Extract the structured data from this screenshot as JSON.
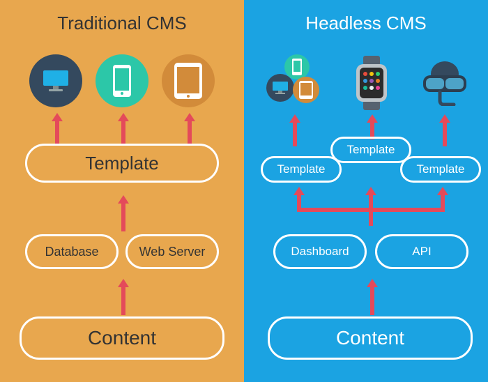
{
  "left": {
    "title": "Traditional CMS",
    "content_label": "Content",
    "db_label": "Database",
    "ws_label": "Web Server",
    "template_label": "Template",
    "devices": [
      "monitor",
      "phone",
      "tablet"
    ]
  },
  "right": {
    "title": "Headless CMS",
    "content_label": "Content",
    "dashboard_label": "Dashboard",
    "api_label": "API",
    "template_label_1": "Template",
    "template_label_2": "Template",
    "template_label_3": "Template",
    "outputs": [
      "device-cluster",
      "smartwatch",
      "vr-headset"
    ]
  }
}
